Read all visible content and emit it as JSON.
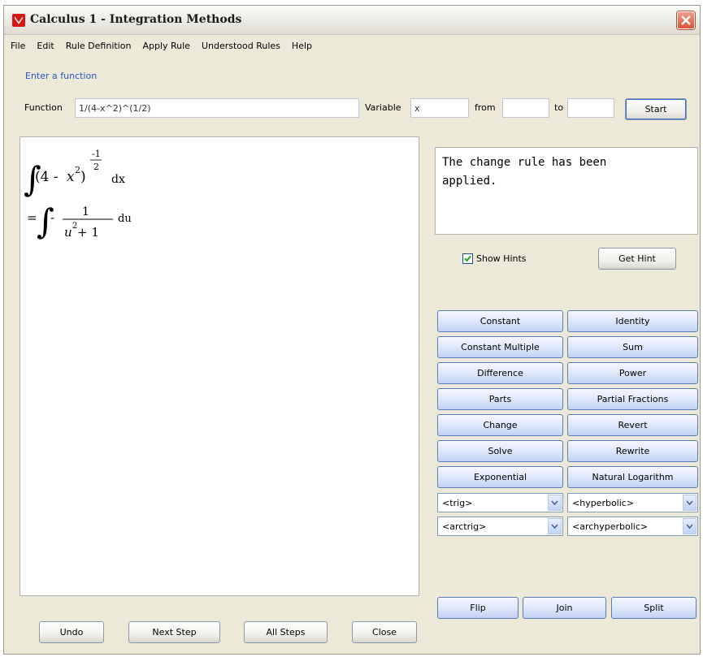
{
  "window": {
    "title": "Calculus 1 - Integration Methods",
    "accent": "#3c6bd6",
    "close_color": "#d8553a"
  },
  "menu": {
    "items": [
      "File",
      "Edit",
      "Rule Definition",
      "Apply Rule",
      "Understood Rules",
      "Help"
    ]
  },
  "entry": {
    "section_label": "Enter a function",
    "function_label": "Function",
    "function_value": "1/(4-x^2)^(1/2)",
    "variable_label": "Variable",
    "variable_value": "x",
    "from_label": "from",
    "from_value": "",
    "to_label": "to",
    "to_value": "",
    "start_label": "Start"
  },
  "math": {
    "line1": {
      "base_open": "(4 - ",
      "x_var": "x",
      "x_exp": "2",
      "close_paren": ")",
      "exp_num": "-1",
      "exp_den": "2",
      "differential": "dx"
    },
    "line2": {
      "equals": "=",
      "minus": "-",
      "numerator": "1",
      "den_var": "u",
      "den_exp": "2",
      "den_rest": " + 1",
      "differential": "du"
    }
  },
  "hints": {
    "message": "The change rule has been\napplied.",
    "show_hints_label": "Show Hints",
    "show_hints_checked": true,
    "get_hint_label": "Get Hint"
  },
  "rules": {
    "buttons": [
      "Constant",
      "Identity",
      "Constant Multiple",
      "Sum",
      "Difference",
      "Power",
      "Parts",
      "Partial Fractions",
      "Change",
      "Revert",
      "Solve",
      "Rewrite",
      "Exponential",
      "Natural Logarithm"
    ],
    "dropdowns": [
      "<trig>",
      "<hyperbolic>",
      "<arctrig>",
      "<archyperbolic>"
    ]
  },
  "transform": {
    "flip_label": "Flip",
    "join_label": "Join",
    "split_label": "Split"
  },
  "footer": {
    "undo_label": "Undo",
    "next_step_label": "Next Step",
    "all_steps_label": "All Steps",
    "close_label": "Close"
  }
}
